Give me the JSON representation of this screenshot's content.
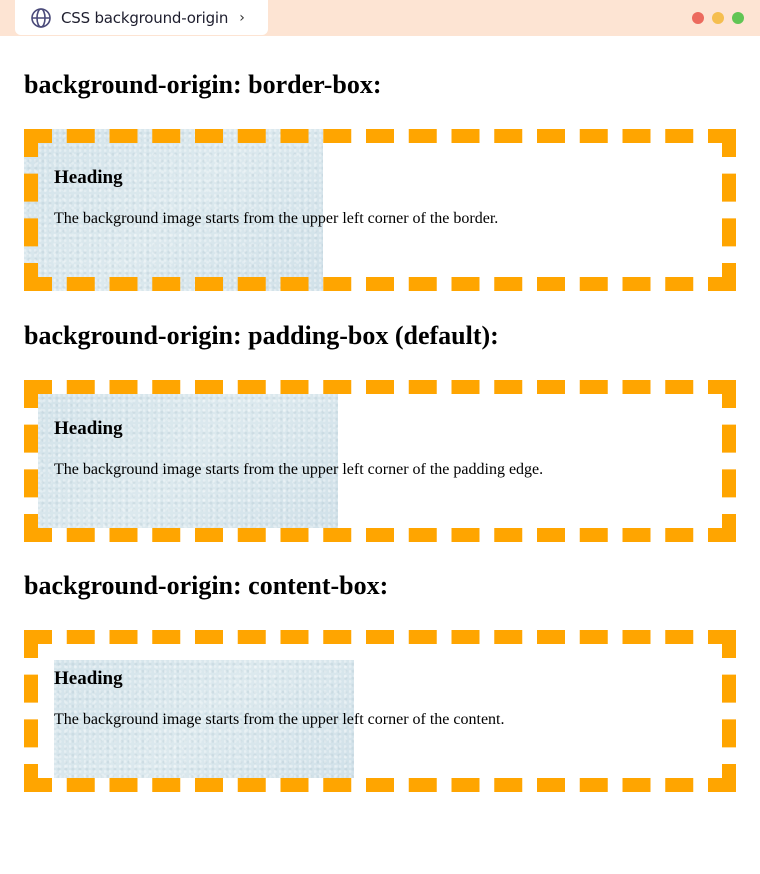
{
  "window": {
    "tab_title": "CSS background-origin",
    "tab_icon": "globe-icon",
    "tab_chevron": "›",
    "controls": [
      "close",
      "minimize",
      "maximize"
    ]
  },
  "colors": {
    "border": "#ffa500",
    "tab_bar": "#fde4d3",
    "image_tint": "#d6e5ec"
  },
  "sections": [
    {
      "title": "background-origin: border-box:",
      "box": {
        "origin": "border-box",
        "heading": "Heading",
        "text": "The background image starts from the upper left corner of the border."
      }
    },
    {
      "title": "background-origin: padding-box (default):",
      "box": {
        "origin": "padding-box",
        "heading": "Heading",
        "text": "The background image starts from the upper left corner of the padding edge."
      }
    },
    {
      "title": "background-origin: content-box:",
      "box": {
        "origin": "content-box",
        "heading": "Heading",
        "text": "The background image starts from the upper left corner of the content."
      }
    }
  ]
}
